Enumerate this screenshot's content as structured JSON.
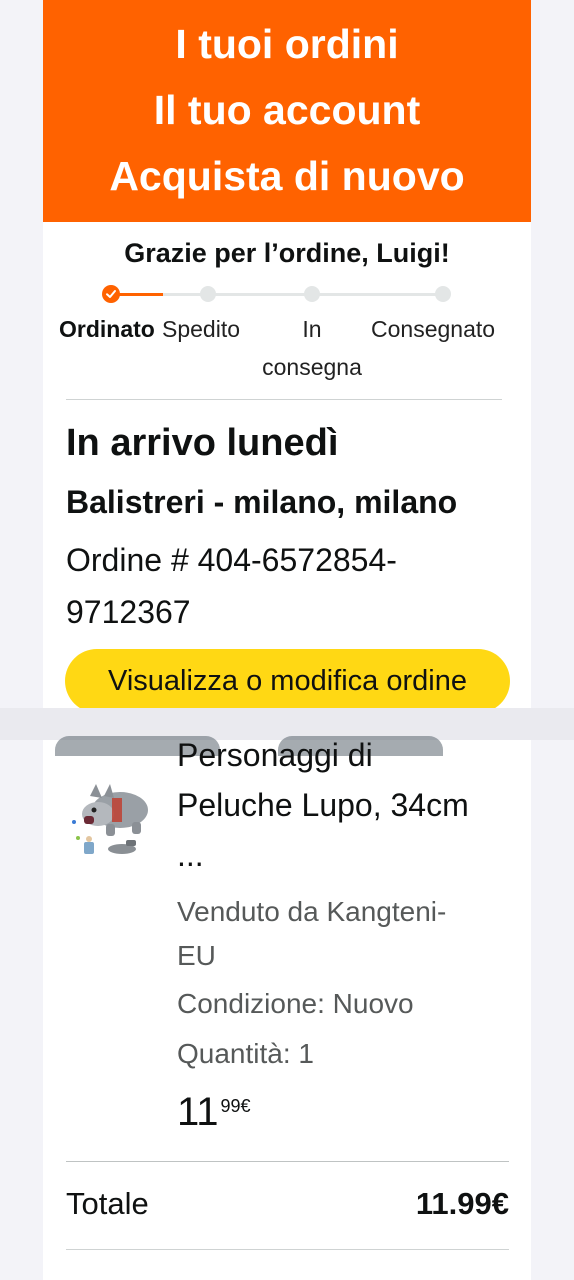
{
  "banner": {
    "orders": "I tuoi ordini",
    "account": "Il tuo account",
    "buy_again": "Acquista di nuovo",
    "color": "#ff6200"
  },
  "greeting": "Grazie per l’ordine, Luigi!",
  "progress": {
    "steps": [
      "Ordinato",
      "Spedito",
      "In consegna",
      "Consegnato"
    ],
    "current_step": 1,
    "in_delivery_line1": "In",
    "in_delivery_line2": "consegna"
  },
  "shipment": {
    "arrival": "In arrivo lunedì",
    "address": "Balistreri - milano, milano",
    "order_line1": "Ordine # 404-6572854-",
    "order_line2": "9712367",
    "button_label": "Visualizza o modifica ordine",
    "button_color": "#ffd814"
  },
  "item": {
    "title_line1": "Personaggi di",
    "title_line2": "Peluche Lupo, 34cm",
    "title_line3": "...",
    "seller_line1": "Venduto da Kangteni-",
    "seller_line2": "EU",
    "condition": "Condizione: Nuovo",
    "quantity": "Quantità: 1",
    "price_whole": "11",
    "price_fraction": "99€",
    "image": "wolf-plush-product-icon"
  },
  "summary": {
    "total_label": "Totale",
    "total_value": "11.99€"
  }
}
